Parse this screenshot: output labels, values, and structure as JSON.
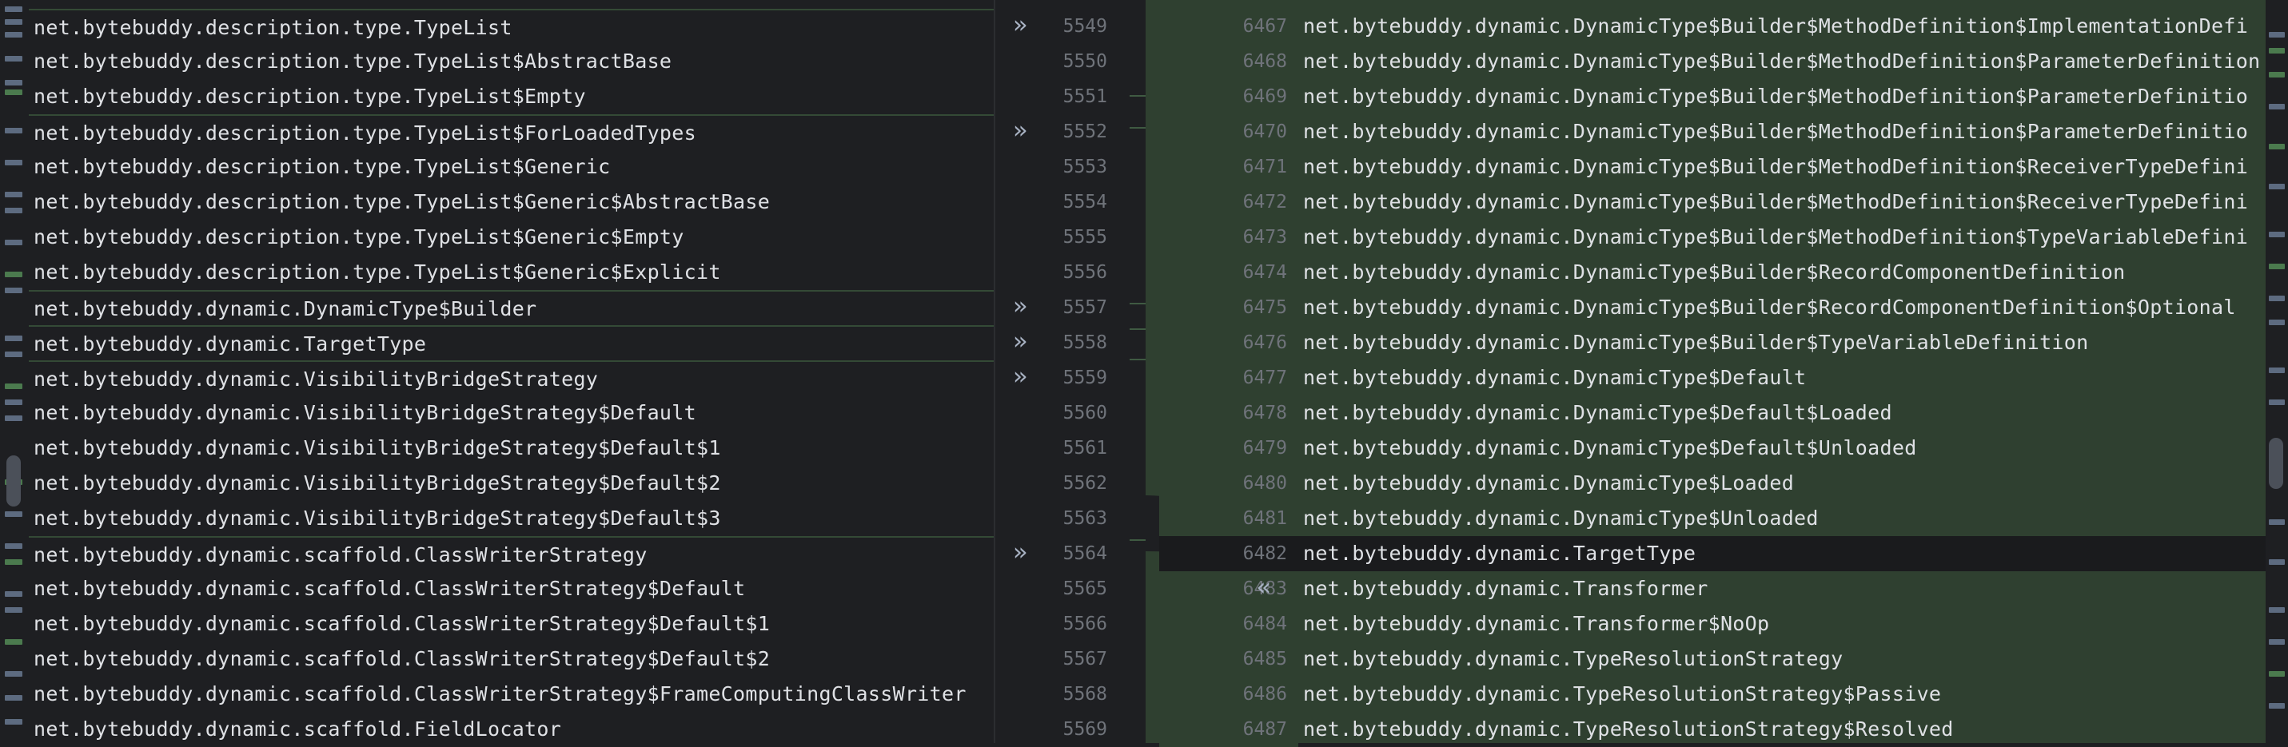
{
  "left_lines": [
    {
      "num": "5549",
      "text": "net.bytebuddy.description.type.TypeList",
      "apply": "»"
    },
    {
      "num": "5550",
      "text": "net.bytebuddy.description.type.TypeList$AbstractBase"
    },
    {
      "num": "5551",
      "text": "net.bytebuddy.description.type.TypeList$Empty"
    },
    {
      "num": "5552",
      "text": "net.bytebuddy.description.type.TypeList$ForLoadedTypes",
      "apply": "»"
    },
    {
      "num": "5553",
      "text": "net.bytebuddy.description.type.TypeList$Generic"
    },
    {
      "num": "5554",
      "text": "net.bytebuddy.description.type.TypeList$Generic$AbstractBase"
    },
    {
      "num": "5555",
      "text": "net.bytebuddy.description.type.TypeList$Generic$Empty"
    },
    {
      "num": "5556",
      "text": "net.bytebuddy.description.type.TypeList$Generic$Explicit"
    },
    {
      "num": "5557",
      "text": "net.bytebuddy.dynamic.DynamicType$Builder",
      "apply": "»"
    },
    {
      "num": "5558",
      "text": "net.bytebuddy.dynamic.TargetType",
      "apply": "»"
    },
    {
      "num": "5559",
      "text": "net.bytebuddy.dynamic.VisibilityBridgeStrategy",
      "apply": "»"
    },
    {
      "num": "5560",
      "text": "net.bytebuddy.dynamic.VisibilityBridgeStrategy$Default"
    },
    {
      "num": "5561",
      "text": "net.bytebuddy.dynamic.VisibilityBridgeStrategy$Default$1"
    },
    {
      "num": "5562",
      "text": "net.bytebuddy.dynamic.VisibilityBridgeStrategy$Default$2"
    },
    {
      "num": "5563",
      "text": "net.bytebuddy.dynamic.VisibilityBridgeStrategy$Default$3"
    },
    {
      "num": "5564",
      "text": "net.bytebuddy.dynamic.scaffold.ClassWriterStrategy",
      "apply": "»"
    },
    {
      "num": "5565",
      "text": "net.bytebuddy.dynamic.scaffold.ClassWriterStrategy$Default"
    },
    {
      "num": "5566",
      "text": "net.bytebuddy.dynamic.scaffold.ClassWriterStrategy$Default$1"
    },
    {
      "num": "5567",
      "text": "net.bytebuddy.dynamic.scaffold.ClassWriterStrategy$Default$2"
    },
    {
      "num": "5568",
      "text": "net.bytebuddy.dynamic.scaffold.ClassWriterStrategy$FrameComputingClassWriter"
    },
    {
      "num": "5569",
      "text": "net.bytebuddy.dynamic.scaffold.FieldLocator"
    }
  ],
  "right_lines": [
    {
      "num": "6467",
      "text": "net.bytebuddy.dynamic.DynamicType$Builder$MethodDefinition$ImplementationDefi"
    },
    {
      "num": "6468",
      "text": "net.bytebuddy.dynamic.DynamicType$Builder$MethodDefinition$ParameterDefinition"
    },
    {
      "num": "6469",
      "text": "net.bytebuddy.dynamic.DynamicType$Builder$MethodDefinition$ParameterDefinitio"
    },
    {
      "num": "6470",
      "text": "net.bytebuddy.dynamic.DynamicType$Builder$MethodDefinition$ParameterDefinitio"
    },
    {
      "num": "6471",
      "text": "net.bytebuddy.dynamic.DynamicType$Builder$MethodDefinition$ReceiverTypeDefini"
    },
    {
      "num": "6472",
      "text": "net.bytebuddy.dynamic.DynamicType$Builder$MethodDefinition$ReceiverTypeDefini"
    },
    {
      "num": "6473",
      "text": "net.bytebuddy.dynamic.DynamicType$Builder$MethodDefinition$TypeVariableDefini"
    },
    {
      "num": "6474",
      "text": "net.bytebuddy.dynamic.DynamicType$Builder$RecordComponentDefinition"
    },
    {
      "num": "6475",
      "text": "net.bytebuddy.dynamic.DynamicType$Builder$RecordComponentDefinition$Optional"
    },
    {
      "num": "6476",
      "text": "net.bytebuddy.dynamic.DynamicType$Builder$TypeVariableDefinition"
    },
    {
      "num": "6477",
      "text": "net.bytebuddy.dynamic.DynamicType$Default"
    },
    {
      "num": "6478",
      "text": "net.bytebuddy.dynamic.DynamicType$Default$Loaded"
    },
    {
      "num": "6479",
      "text": "net.bytebuddy.dynamic.DynamicType$Default$Unloaded"
    },
    {
      "num": "6480",
      "text": "net.bytebuddy.dynamic.DynamicType$Loaded"
    },
    {
      "num": "6481",
      "text": "net.bytebuddy.dynamic.DynamicType$Unloaded"
    },
    {
      "num": "6482",
      "text": "net.bytebuddy.dynamic.TargetType",
      "current": true
    },
    {
      "num": "6483",
      "text": "net.bytebuddy.dynamic.Transformer",
      "apply": "«"
    },
    {
      "num": "6484",
      "text": "net.bytebuddy.dynamic.Transformer$NoOp"
    },
    {
      "num": "6485",
      "text": "net.bytebuddy.dynamic.TypeResolutionStrategy"
    },
    {
      "num": "6486",
      "text": "net.bytebuddy.dynamic.TypeResolutionStrategy$Passive"
    },
    {
      "num": "6487",
      "text": "net.bytebuddy.dynamic.TypeResolutionStrategy$Resolved"
    }
  ],
  "colors": {
    "background": "#1e1f22",
    "added": "#2f4030",
    "change_border": "#344a36",
    "text": "#dfe1e5",
    "line_number": "#6f737a",
    "arrow": "#a9b3c4"
  },
  "icons": {
    "apply_left": "double-chevron-right-icon",
    "apply_right": "double-chevron-left-icon"
  }
}
